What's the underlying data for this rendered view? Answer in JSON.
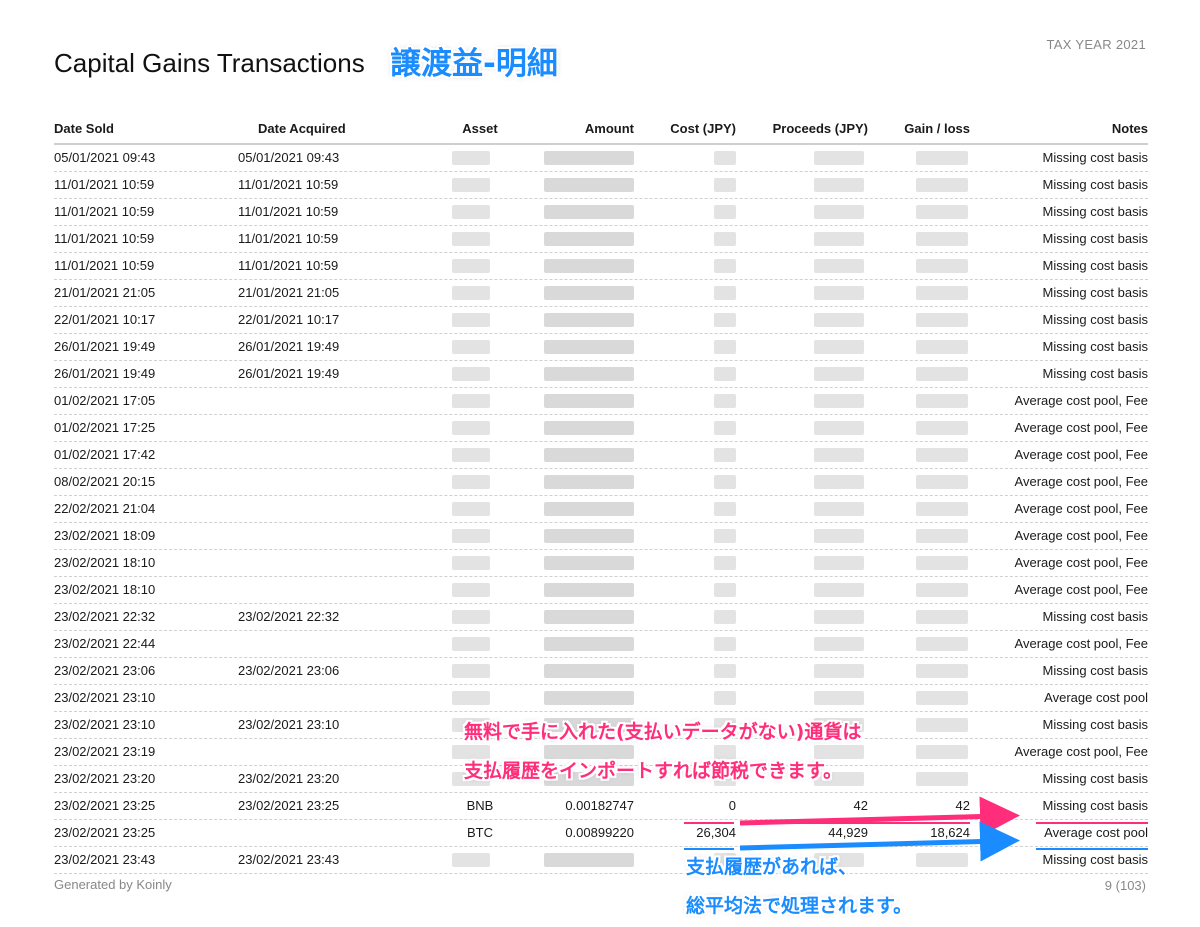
{
  "header": {
    "title": "Capital Gains Transactions",
    "title_jp": "譲渡益-明細",
    "tax_year": "TAX YEAR 2021"
  },
  "columns": [
    "Date Sold",
    "Date Acquired",
    "Asset",
    "Amount",
    "Cost (JPY)",
    "Proceeds (JPY)",
    "Gain / loss",
    "Notes"
  ],
  "rows": [
    {
      "sold": "05/01/2021 09:43",
      "acquired": "05/01/2021 09:43",
      "notes": "Missing cost basis"
    },
    {
      "sold": "11/01/2021 10:59",
      "acquired": "11/01/2021 10:59",
      "notes": "Missing cost basis"
    },
    {
      "sold": "11/01/2021 10:59",
      "acquired": "11/01/2021 10:59",
      "notes": "Missing cost basis"
    },
    {
      "sold": "11/01/2021 10:59",
      "acquired": "11/01/2021 10:59",
      "notes": "Missing cost basis"
    },
    {
      "sold": "11/01/2021 10:59",
      "acquired": "11/01/2021 10:59",
      "notes": "Missing cost basis"
    },
    {
      "sold": "21/01/2021 21:05",
      "acquired": "21/01/2021 21:05",
      "notes": "Missing cost basis"
    },
    {
      "sold": "22/01/2021 10:17",
      "acquired": "22/01/2021 10:17",
      "notes": "Missing cost basis"
    },
    {
      "sold": "26/01/2021 19:49",
      "acquired": "26/01/2021 19:49",
      "notes": "Missing cost basis"
    },
    {
      "sold": "26/01/2021 19:49",
      "acquired": "26/01/2021 19:49",
      "notes": "Missing cost basis"
    },
    {
      "sold": "01/02/2021 17:05",
      "acquired": "",
      "notes": "Average cost pool, Fee"
    },
    {
      "sold": "01/02/2021 17:25",
      "acquired": "",
      "notes": "Average cost pool, Fee"
    },
    {
      "sold": "01/02/2021 17:42",
      "acquired": "",
      "notes": "Average cost pool, Fee"
    },
    {
      "sold": "08/02/2021 20:15",
      "acquired": "",
      "notes": "Average cost pool, Fee"
    },
    {
      "sold": "22/02/2021 21:04",
      "acquired": "",
      "notes": "Average cost pool, Fee"
    },
    {
      "sold": "23/02/2021 18:09",
      "acquired": "",
      "notes": "Average cost pool, Fee"
    },
    {
      "sold": "23/02/2021 18:10",
      "acquired": "",
      "notes": "Average cost pool, Fee"
    },
    {
      "sold": "23/02/2021 18:10",
      "acquired": "",
      "notes": "Average cost pool, Fee"
    },
    {
      "sold": "23/02/2021 22:32",
      "acquired": "23/02/2021 22:32",
      "notes": "Missing cost basis"
    },
    {
      "sold": "23/02/2021 22:44",
      "acquired": "",
      "notes": "Average cost pool, Fee"
    },
    {
      "sold": "23/02/2021 23:06",
      "acquired": "23/02/2021 23:06",
      "notes": "Missing cost basis"
    },
    {
      "sold": "23/02/2021 23:10",
      "acquired": "",
      "notes": "Average cost pool"
    },
    {
      "sold": "23/02/2021 23:10",
      "acquired": "23/02/2021 23:10",
      "notes": "Missing cost basis"
    },
    {
      "sold": "23/02/2021 23:19",
      "acquired": "",
      "notes": "Average cost pool, Fee"
    },
    {
      "sold": "23/02/2021 23:20",
      "acquired": "23/02/2021 23:20",
      "notes": "Missing cost basis"
    },
    {
      "sold": "23/02/2021 23:25",
      "acquired": "23/02/2021 23:25",
      "asset": "BNB",
      "amount": "0.00182747",
      "cost": "0",
      "proceeds": "42",
      "gain": "42",
      "notes": "Missing cost basis"
    },
    {
      "sold": "23/02/2021 23:25",
      "acquired": "",
      "asset": "BTC",
      "amount": "0.00899220",
      "cost": "26,304",
      "proceeds": "44,929",
      "gain": "18,624",
      "notes": "Average cost pool"
    },
    {
      "sold": "23/02/2021 23:43",
      "acquired": "23/02/2021 23:43",
      "notes": "Missing cost basis"
    }
  ],
  "annotations": {
    "pink_line1": "無料で手に入れた(支払いデータがない)通貨は",
    "pink_line2": "支払履歴をインポートすれば節税できます。",
    "blue_line1": "支払履歴があれば、",
    "blue_line2": "総平均法で処理されます。"
  },
  "footer": {
    "generated_by": "Generated by Koinly",
    "page": "9 (103)"
  },
  "colors": {
    "pink": "#ff2d7a",
    "blue": "#1a8cff"
  }
}
